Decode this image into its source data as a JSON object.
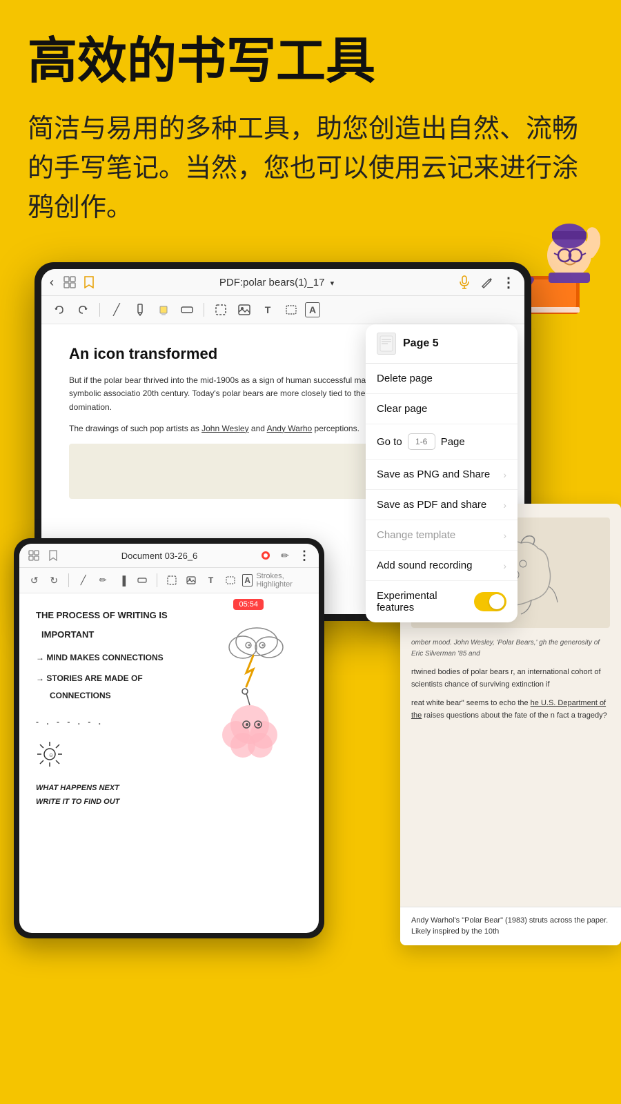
{
  "hero": {
    "title": "高效的书写工具",
    "subtitle": "简洁与易用的多种工具，助您创造出自然、流畅的手写笔记。当然，您也可以使用云记来进行涂鸦创作。"
  },
  "toolbar": {
    "back_icon": "‹",
    "title": "PDF:polar bears(1)_17",
    "title_arrow": "∨",
    "mic_icon": "🎤",
    "pen_icon": "✏",
    "more_icon": "⋮",
    "undo_icon": "↺",
    "redo_icon": "↻",
    "pen_tool": "/",
    "pencil_tool": "✏",
    "highlighter_tool": "▐",
    "eraser_tool": "◻",
    "selection_tool": "⬚",
    "image_tool": "⛶",
    "text_tool": "T",
    "shape_tool": "⬡",
    "font_tool": "A"
  },
  "context_menu": {
    "page_label": "Page 5",
    "items": [
      {
        "label": "Delete page",
        "disabled": false,
        "has_chevron": false
      },
      {
        "label": "Clear page",
        "disabled": false,
        "has_chevron": false
      },
      {
        "label": "Go to",
        "type": "goto",
        "input_placeholder": "1-6",
        "page_label": "Page"
      },
      {
        "label": "Save as PNG and Share",
        "disabled": false,
        "has_chevron": true
      },
      {
        "label": "Save as PDF and share",
        "disabled": false,
        "has_chevron": true
      },
      {
        "label": "Change template",
        "disabled": true,
        "has_chevron": true
      },
      {
        "label": "Add sound recording",
        "disabled": false,
        "has_chevron": true
      },
      {
        "label": "Experimental features",
        "type": "toggle",
        "toggle_on": true
      }
    ]
  },
  "doc": {
    "heading": "An icon transformed",
    "body1": "But if the polar bear thrived into the mid-1900s as a sign of human successful mastery of antagonistic forces, this symbolic associatio 20th century. Today's polar bears are more closely tied to the dem belief in conquest and domination.",
    "body2": "The drawings of such pop artists as John Wesley and Andy Warho perceptions."
  },
  "second_device": {
    "title": "Document 03-26_6",
    "timer": "05:54",
    "strokes_label": "Strokes, Highlighter",
    "lines": [
      "THE PROCESS OF WRITING IS",
      "IMPORTANT",
      "→ MIND MAKES CONNECTIONS",
      "→ STORIES ARE MADE OF",
      "   CONNECTIONS",
      "WHAT HAPPENS NEXT",
      "WRITE IT TO FIND OUT"
    ]
  },
  "pdf_right": {
    "caption": "omber mood. John Wesley, 'Polar Bears,' gh the generosity of Eric Silverman '85 and",
    "body1": "rtwined bodies of polar bears r, an international cohort of scientists chance of surviving extinction if",
    "body2": "reat white bear\" seems to echo the he U.S. Department of the raises questions about the fate of the n fact a tragedy?",
    "footer": "Andy Warhol's \"Polar Bear\" (1983) struts across the paper. Likely inspired by the 10th",
    "dept_text": "Department of the"
  },
  "colors": {
    "background": "#F5C400",
    "device_frame": "#1a1a1a",
    "menu_bg": "#ffffff",
    "toggle_active": "#F5C400"
  }
}
